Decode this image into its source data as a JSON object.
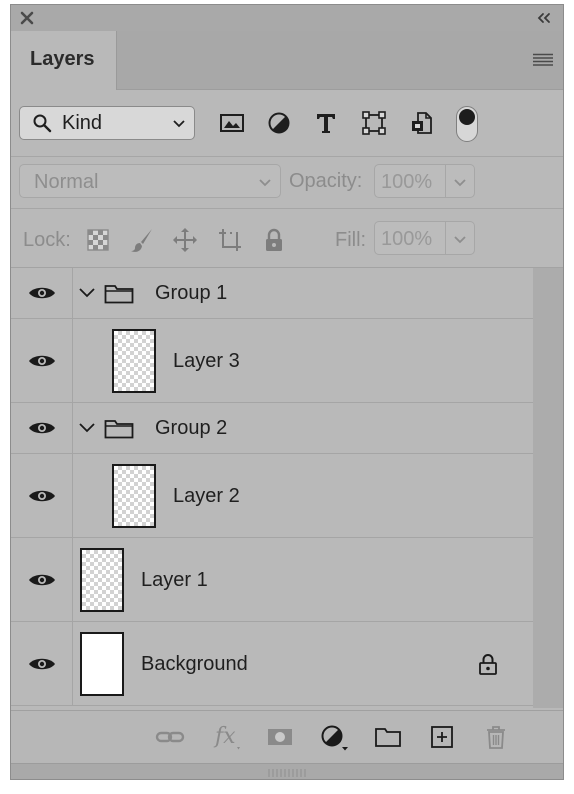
{
  "panel": {
    "tab_label": "Layers"
  },
  "filter": {
    "kind_label": "Kind",
    "icons": [
      "image-filter-icon",
      "adjustment-filter-icon",
      "type-filter-icon",
      "shape-filter-icon",
      "smart-object-filter-icon"
    ],
    "toggle_on": true
  },
  "blend": {
    "mode": "Normal",
    "opacity_label": "Opacity:",
    "opacity_value": "100%"
  },
  "lock": {
    "label": "Lock:",
    "icons": [
      "lock-transparent-pixels-icon",
      "lock-image-pixels-icon",
      "lock-position-icon",
      "lock-artboard-icon",
      "lock-all-icon"
    ],
    "fill_label": "Fill:",
    "fill_value": "100%"
  },
  "layers": [
    {
      "name": "Group 1",
      "type": "group",
      "visible": true
    },
    {
      "name": "Layer 3",
      "type": "layer",
      "visible": true,
      "indent": true,
      "thumbnail": "transparent"
    },
    {
      "name": "Group 2",
      "type": "group",
      "visible": true
    },
    {
      "name": "Layer 2",
      "type": "layer",
      "visible": true,
      "indent": true,
      "thumbnail": "transparent"
    },
    {
      "name": "Layer 1",
      "type": "layer",
      "visible": true,
      "thumbnail": "transparent"
    },
    {
      "name": "Background",
      "type": "layer",
      "visible": true,
      "thumbnail": "white",
      "locked": true
    }
  ],
  "bottom_toolbar": [
    "link-layers-icon",
    "layer-style-icon",
    "layer-mask-icon",
    "adjustment-layer-icon",
    "new-group-icon",
    "new-layer-icon",
    "delete-layer-icon"
  ],
  "colors": {
    "panel_bg": "#b9b9b9",
    "header_bg": "#a8a8a8",
    "text": "#1f1f1f",
    "disabled_text": "#8c8c8c"
  }
}
